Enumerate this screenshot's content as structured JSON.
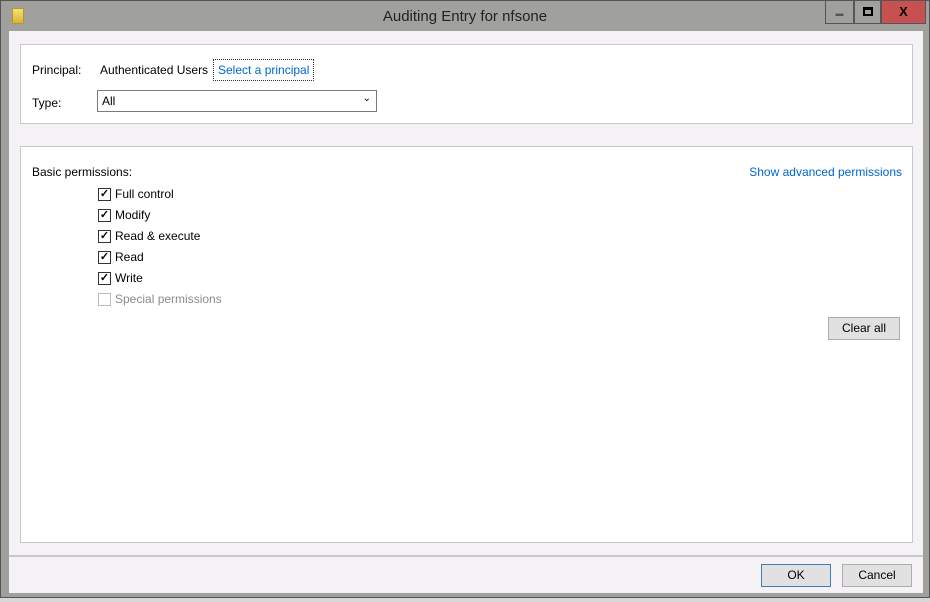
{
  "window": {
    "title": "Auditing Entry for nfsone",
    "minimize": "▬",
    "maximize": "□",
    "close": "X"
  },
  "principal": {
    "label": "Principal:",
    "value": "Authenticated Users",
    "link": "Select a principal"
  },
  "type": {
    "label": "Type:",
    "value": "All"
  },
  "permissions": {
    "label": "Basic permissions:",
    "advanced_link": "Show advanced permissions",
    "items": [
      {
        "label": "Full control",
        "checked": true,
        "enabled": true
      },
      {
        "label": "Modify",
        "checked": true,
        "enabled": true
      },
      {
        "label": "Read & execute",
        "checked": true,
        "enabled": true
      },
      {
        "label": "Read",
        "checked": true,
        "enabled": true
      },
      {
        "label": "Write",
        "checked": true,
        "enabled": true
      },
      {
        "label": "Special permissions",
        "checked": false,
        "enabled": false
      }
    ],
    "clear_all": "Clear all"
  },
  "footer": {
    "ok": "OK",
    "cancel": "Cancel"
  }
}
